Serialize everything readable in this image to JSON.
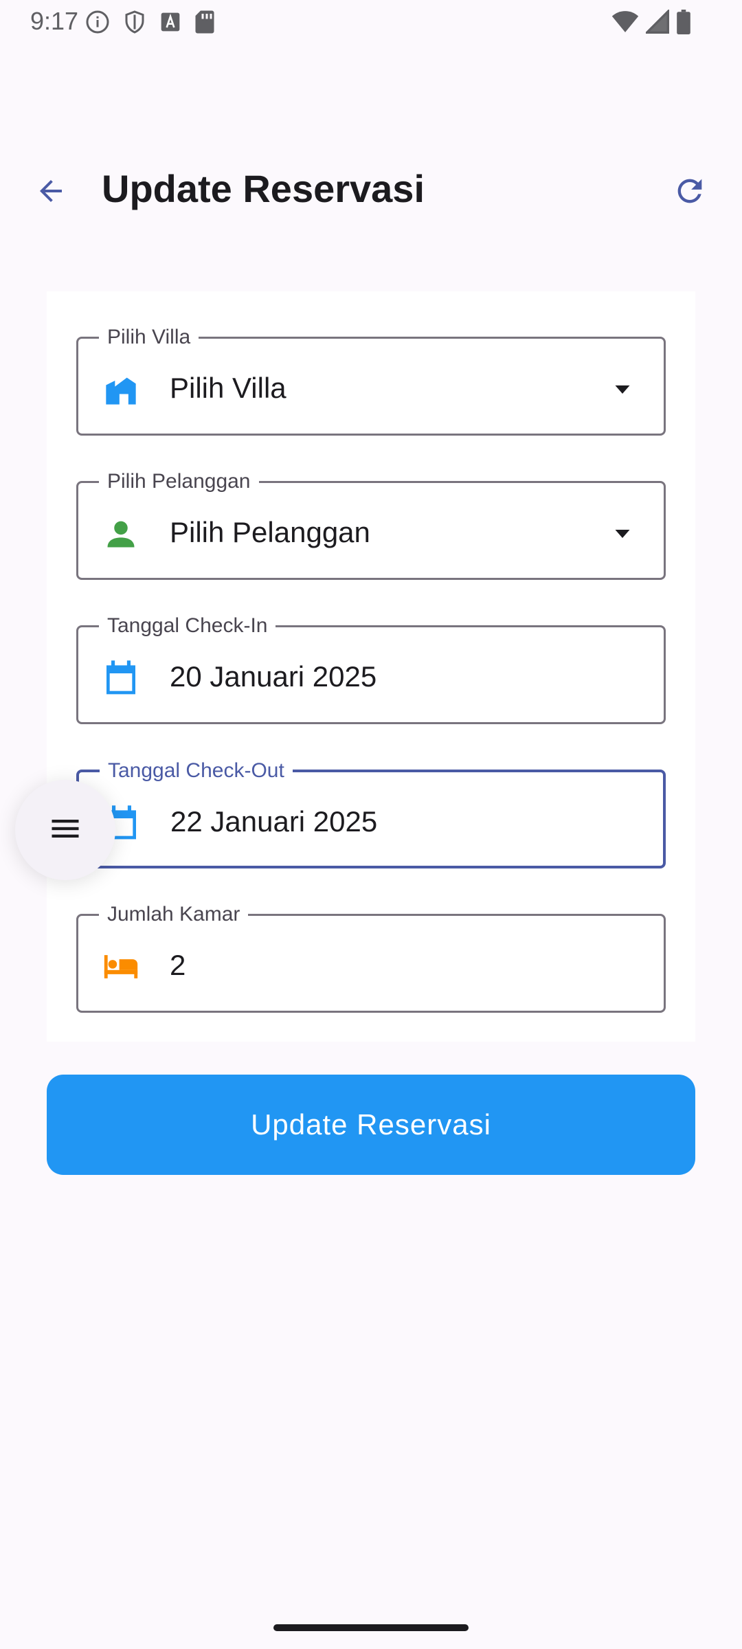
{
  "status_bar": {
    "time": "9:17",
    "left_icons": [
      "info-icon",
      "shield-icon",
      "text-a-icon",
      "sd-card-icon"
    ],
    "right_icons": [
      "wifi-icon",
      "signal-icon",
      "battery-icon"
    ]
  },
  "app_bar": {
    "title": "Update Reservasi",
    "back_icon": "arrow-back-icon",
    "refresh_icon": "refresh-icon"
  },
  "form": {
    "villa": {
      "label": "Pilih Villa",
      "value": "Pilih Villa",
      "icon": "villa-icon"
    },
    "customer": {
      "label": "Pilih Pelanggan",
      "value": "Pilih Pelanggan",
      "icon": "person-icon"
    },
    "checkin": {
      "label": "Tanggal Check-In",
      "value": "20 Januari 2025",
      "icon": "calendar-icon"
    },
    "checkout": {
      "label": "Tanggal Check-Out",
      "value": "22 Januari 2025",
      "icon": "calendar-icon"
    },
    "rooms": {
      "label": "Jumlah Kamar",
      "value": "2",
      "icon": "bed-icon"
    }
  },
  "submit_button": {
    "label": "Update Reservasi"
  },
  "colors": {
    "primary": "#2196f3",
    "focus": "#4a5aa5",
    "person_icon": "#43a047",
    "bed_icon": "#fb8c00"
  }
}
